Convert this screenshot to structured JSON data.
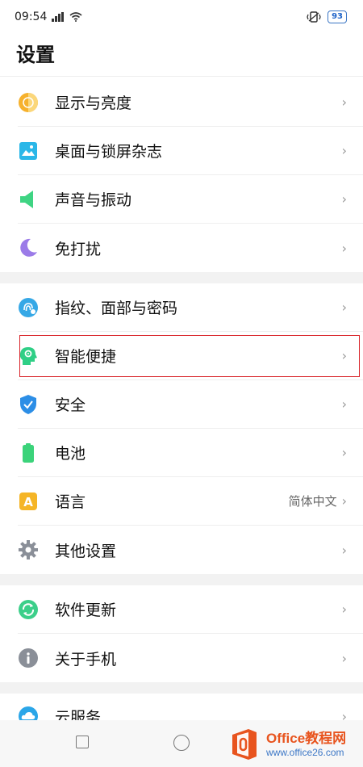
{
  "status": {
    "time": "09:54",
    "battery": "93"
  },
  "title": "设置",
  "groups": [
    {
      "items": [
        {
          "label": "显示与亮度",
          "icon": "display-brightness-icon"
        },
        {
          "label": "桌面与锁屏杂志",
          "icon": "wallpaper-icon"
        },
        {
          "label": "声音与振动",
          "icon": "speaker-icon"
        },
        {
          "label": "免打扰",
          "icon": "moon-icon"
        }
      ]
    },
    {
      "items": [
        {
          "label": "指纹、面部与密码",
          "icon": "fingerprint-face-icon"
        },
        {
          "label": "智能便捷",
          "icon": "smart-head-icon"
        },
        {
          "label": "安全",
          "icon": "shield-icon"
        },
        {
          "label": "电池",
          "icon": "battery-icon"
        },
        {
          "label": "语言",
          "icon": "language-icon",
          "value": "简体中文"
        },
        {
          "label": "其他设置",
          "icon": "gear-icon"
        }
      ]
    },
    {
      "items": [
        {
          "label": "软件更新",
          "icon": "update-icon"
        },
        {
          "label": "关于手机",
          "icon": "info-icon"
        }
      ]
    },
    {
      "items": [
        {
          "label": "云服务",
          "icon": "cloud-icon"
        }
      ]
    }
  ],
  "chevron": "›",
  "watermark": {
    "top": "Office教程网",
    "bottom": "www.office26.com"
  },
  "colors": {
    "highlight": "#d9252a",
    "group_gap": "#f2f2f2"
  }
}
